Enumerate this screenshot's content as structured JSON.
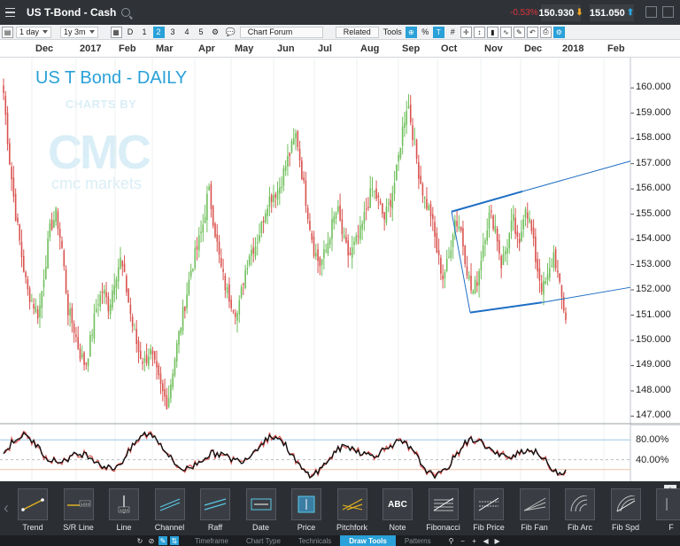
{
  "window": {
    "title": "US T-Bond - Cash",
    "change": "-0.53%",
    "sell_price": "150.930",
    "buy_price": "151.050"
  },
  "toolbar": {
    "interval": "1 day",
    "range": "1y 3m",
    "timeframes": [
      "D",
      "1",
      "2",
      "3",
      "4",
      "5"
    ],
    "active_timeframe": "2",
    "chart_forum": "Chart Forum",
    "related": "Related",
    "tools": "Tools",
    "percent": "%",
    "hash": "#"
  },
  "chart": {
    "headline": "US T Bond  - DAILY",
    "watermark_sub": "CHARTS BY",
    "watermark_logo": "CMC",
    "watermark_brand": "cmc markets",
    "months": [
      "Dec",
      "2017",
      "Feb",
      "Mar",
      "Apr",
      "May",
      "Jun",
      "Jul",
      "Aug",
      "Sep",
      "Oct",
      "Nov",
      "Dec",
      "2018",
      "Feb"
    ],
    "price_ticks": [
      "160.000",
      "159.000",
      "158.000",
      "157.000",
      "156.000",
      "155.000",
      "154.000",
      "153.000",
      "152.000",
      "151.000",
      "150.000",
      "149.000",
      "148.000",
      "147.000"
    ],
    "osc_ticks": [
      "80.00%",
      "40.00%"
    ]
  },
  "chart_data": {
    "type": "candlestick",
    "title": "US T Bond  - DAILY",
    "ylim": [
      146.7,
      161.2
    ],
    "last_close": 150.9,
    "closes_weekly": [
      159.8,
      157.2,
      155.1,
      153.5,
      152.0,
      151.5,
      151.0,
      152.8,
      154.5,
      155.0,
      153.6,
      151.2,
      150.5,
      149.5,
      149.0,
      150.2,
      151.5,
      152.0,
      151.3,
      152.5,
      153.2,
      152.0,
      150.6,
      149.6,
      149.1,
      149.6,
      148.8,
      148.0,
      147.5,
      149.0,
      150.3,
      151.5,
      152.8,
      153.6,
      154.5,
      156.0,
      154.5,
      153.0,
      152.0,
      151.5,
      151.0,
      152.5,
      153.5,
      153.8,
      154.5,
      155.5,
      155.8,
      156.0,
      156.8,
      157.5,
      158.2,
      156.5,
      155.0,
      153.6,
      153.0,
      153.5,
      154.5,
      155.2,
      154.0,
      153.3,
      153.8,
      154.3,
      155.3,
      156.0,
      155.5,
      154.8,
      155.5,
      156.5,
      158.2,
      159.5,
      158.0,
      156.5,
      155.5,
      155.0,
      153.5,
      152.5,
      153.2,
      154.8,
      154.5,
      153.0,
      151.8,
      152.5,
      154.0,
      155.0,
      154.5,
      153.0,
      153.8,
      154.8,
      153.5,
      155.5,
      154.5,
      153.0,
      152.0,
      152.5,
      153.5,
      152.0,
      150.9
    ],
    "oscillator": {
      "upper": 80,
      "lower": 40
    },
    "trendlines": [
      {
        "from": [
          "Oct",
          155.1
        ],
        "to": [
          "Dec",
          155.9
        ]
      },
      {
        "from": [
          "Dec",
          155.9
        ],
        "to": [
          "Feb",
          157.1
        ]
      },
      {
        "from": [
          "Oct",
          151.1
        ],
        "to": [
          "Dec",
          151.5
        ]
      },
      {
        "from": [
          "Dec",
          151.5
        ],
        "to": [
          "Feb",
          152.1
        ]
      }
    ]
  },
  "draw_tools": [
    {
      "label": "Trend",
      "icon": "trend-icon"
    },
    {
      "label": "S/R Line",
      "icon": "sr-line-icon"
    },
    {
      "label": "Line",
      "icon": "line-icon"
    },
    {
      "label": "Channel",
      "icon": "channel-icon"
    },
    {
      "label": "Raff",
      "icon": "raff-icon"
    },
    {
      "label": "Date",
      "icon": "date-icon"
    },
    {
      "label": "Price",
      "icon": "price-icon"
    },
    {
      "label": "Pitchfork",
      "icon": "pitchfork-icon"
    },
    {
      "label": "Note",
      "icon": "note-icon"
    },
    {
      "label": "Fibonacci",
      "icon": "fibonacci-icon"
    },
    {
      "label": "Fib Price",
      "icon": "fib-price-icon"
    },
    {
      "label": "Fib Fan",
      "icon": "fib-fan-icon"
    },
    {
      "label": "Fib Arc",
      "icon": "fib-arc-icon"
    },
    {
      "label": "Fib Spd",
      "icon": "fib-spd-icon"
    },
    {
      "label": "F",
      "icon": "more-icon"
    }
  ],
  "note_icon_text": "ABC",
  "sr_line_icon_text": "1234",
  "bottom_tabs": [
    "Timeframe",
    "Chart Type",
    "Technicals",
    "Draw Tools",
    "Patterns"
  ],
  "active_tab": "Draw Tools"
}
